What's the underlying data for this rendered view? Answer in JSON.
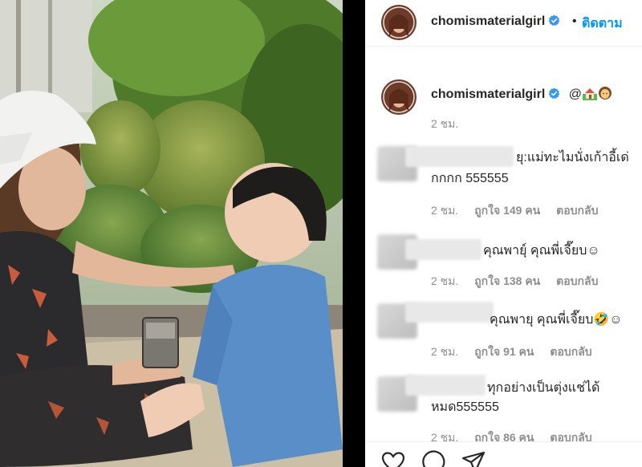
{
  "post": {
    "username": "chomismaterialgirl",
    "dot": "•",
    "follow_label": "ติดตาม",
    "caption": {
      "text": "@",
      "emojis": [
        "house-with-garden-emoji",
        "woman-emoji"
      ],
      "time": "2 ชม."
    }
  },
  "comments": [
    {
      "text_line1": "ยุ:แม่ทะไมนั่งเก้าอี้เด่",
      "text_line2": "กกกก 555555",
      "time": "2 ชม.",
      "likes": "ถูกใจ 149 คน",
      "reply": "ตอบกลับ"
    },
    {
      "text_line1": "คุณพายุ์ คุณพี่เจี๊ยบ☺",
      "time": "2 ชม.",
      "likes": "ถูกใจ 138 คน",
      "reply": "ตอบกลับ"
    },
    {
      "text_line1": "คุณพายุ คุณพี่เจี๊ยบ🤣☺",
      "time": "2 ชม.",
      "likes": "ถูกใจ 91 คน",
      "reply": "ตอบกลับ"
    },
    {
      "text_line1": "ทุกอย่างเป็นตุ่งแช่ได้",
      "text_line2": "หมด555555",
      "time": "2 ชม.",
      "likes": "ถูกใจ 86 คน",
      "reply": "ตอบกลับ"
    }
  ],
  "actions": {
    "icons": [
      "heart-icon",
      "comment-icon",
      "share-icon"
    ]
  },
  "colors": {
    "link_blue": "#0095f6",
    "verified_blue": "#3897f0",
    "text": "#262626",
    "muted": "#8e8e8e"
  }
}
